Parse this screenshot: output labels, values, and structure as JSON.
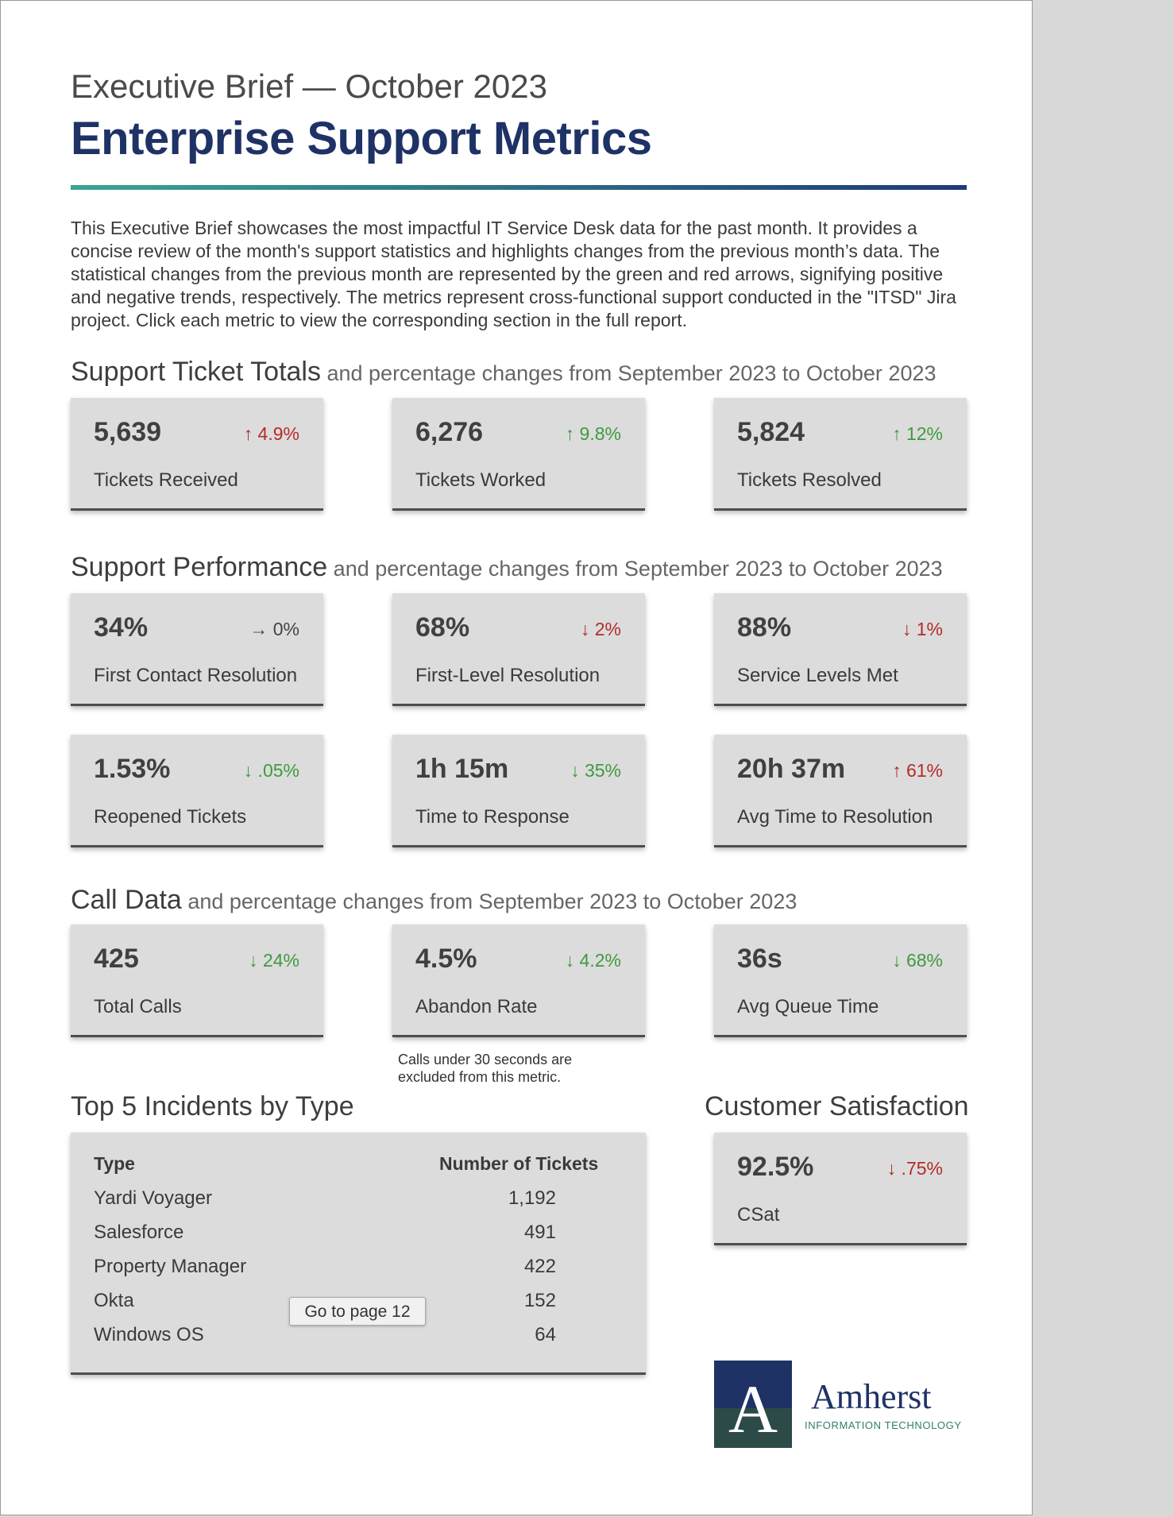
{
  "header": {
    "subtitle": "Executive Brief — October 2023",
    "title": "Enterprise Support Metrics"
  },
  "intro": "This Executive Brief showcases the most impactful IT Service Desk data for the past month. It provides a concise review of the month's support statistics and highlights changes from the previous month’s data. The statistical changes from the previous month are represented by the green and red arrows, signifying positive and negative trends, respectively. The metrics represent cross-functional support conducted in the \"ITSD\" Jira project. Click each metric to view the corresponding section in the full report.",
  "sections": {
    "totals": {
      "title": "Support Ticket Totals",
      "subtitle": " and percentage changes from September 2023 to October 2023",
      "cards": [
        {
          "value": "5,639",
          "change": "↑ 4.9%",
          "label": "Tickets Received",
          "trend": "up-red"
        },
        {
          "value": "6,276",
          "change": "↑ 9.8%",
          "label": "Tickets Worked",
          "trend": "up-green"
        },
        {
          "value": "5,824",
          "change": "↑ 12%",
          "label": "Tickets Resolved",
          "trend": "up-green"
        }
      ]
    },
    "performance": {
      "title": "Support Performance",
      "subtitle": " and percentage changes from September 2023 to October 2023",
      "cards": [
        {
          "value": "34%",
          "change": "→ 0%",
          "label": "First Contact Resolution",
          "trend": "neutral"
        },
        {
          "value": "68%",
          "change": "↓ 2%",
          "label": "First-Level Resolution",
          "trend": "down-red"
        },
        {
          "value": "88%",
          "change": "↓ 1%",
          "label": "Service Levels Met",
          "trend": "down-red"
        },
        {
          "value": "1.53%",
          "change": "↓ .05%",
          "label": "Reopened Tickets",
          "trend": "down-green"
        },
        {
          "value": "1h 15m",
          "change": "↓ 35%",
          "label": "Time to Response",
          "trend": "down-green"
        },
        {
          "value": "20h 37m",
          "change": "↑ 61%",
          "label": "Avg Time to Resolution",
          "trend": "up-red"
        }
      ]
    },
    "calls": {
      "title": "Call Data",
      "subtitle": " and percentage changes from September 2023 to October 2023",
      "cards": [
        {
          "value": "425",
          "change": "↓ 24%",
          "label": "Total Calls",
          "trend": "down-green"
        },
        {
          "value": "4.5%",
          "change": "↓ 4.2%",
          "label": "Abandon Rate",
          "trend": "down-green"
        },
        {
          "value": "36s",
          "change": "↓ 68%",
          "label": "Avg Queue Time",
          "trend": "down-green"
        }
      ],
      "note": "Calls under 30 seconds are excluded from this metric."
    },
    "incidents": {
      "title": "Top 5 Incidents by Type",
      "col_type": "Type",
      "col_count": "Number of Tickets",
      "rows": [
        {
          "type": "Yardi Voyager",
          "count": "1,192"
        },
        {
          "type": "Salesforce",
          "count": "491"
        },
        {
          "type": "Property Manager",
          "count": "422"
        },
        {
          "type": "Okta",
          "count": "152"
        },
        {
          "type": "Windows OS",
          "count": "64"
        }
      ]
    },
    "csat": {
      "title": "Customer Satisfaction",
      "card": {
        "value": "92.5%",
        "change": "↓ .75%",
        "label": "CSat",
        "trend": "down-red"
      }
    }
  },
  "tooltip": "Go to page 12",
  "logo": {
    "name": "Amherst",
    "mark": "A",
    "sub": "INFORMATION TECHNOLOGY",
    "colors": {
      "navy": "#1f3266",
      "green": "#2c4a47"
    }
  },
  "colors": {
    "title": "#1f3266",
    "positive": "#3f9a3f",
    "negative": "#b52a2a",
    "rule_start": "#3aa593",
    "rule_end": "#1f3a78"
  }
}
